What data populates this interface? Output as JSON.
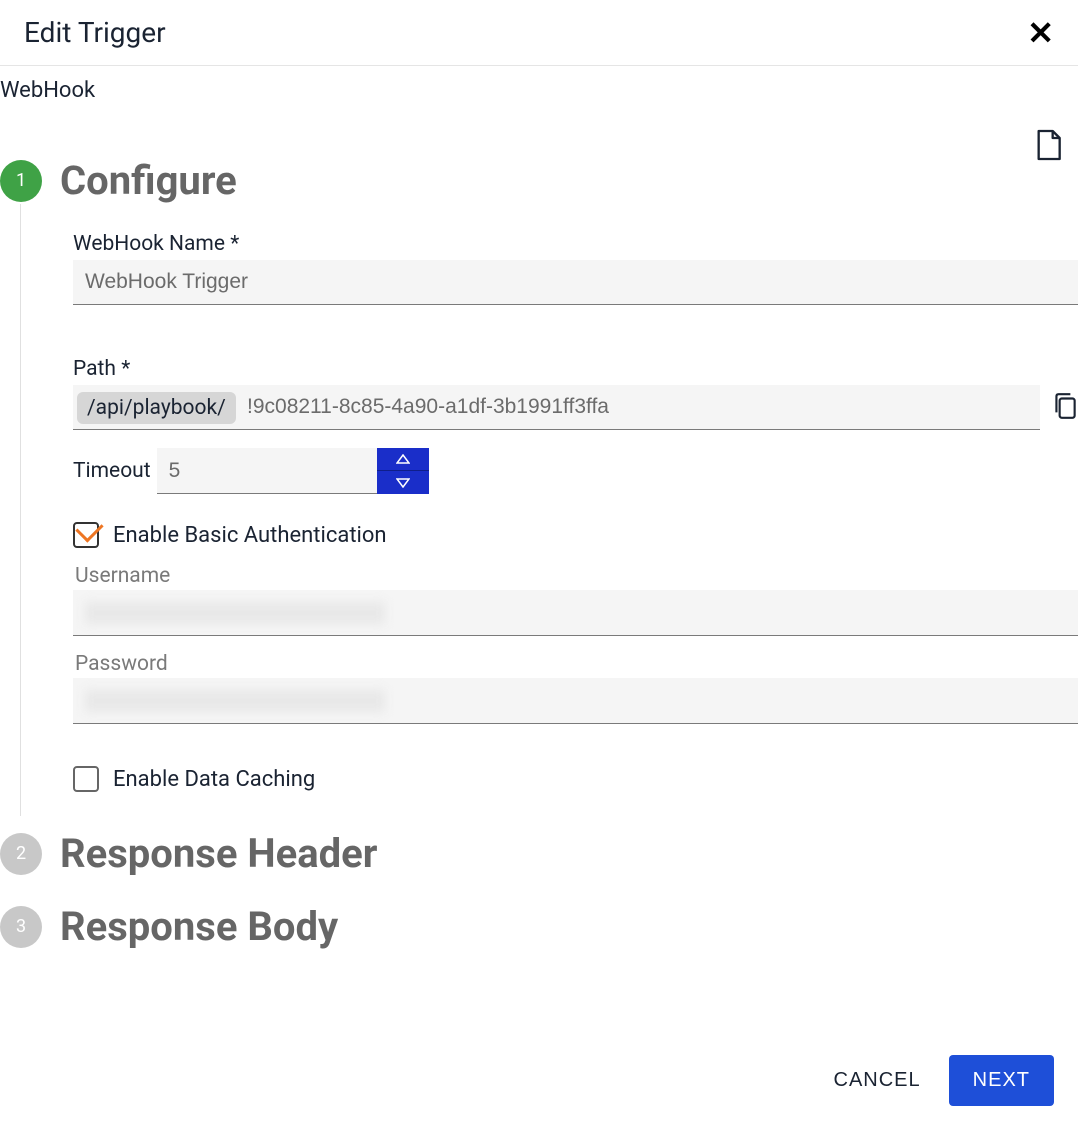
{
  "header": {
    "title": "Edit Trigger"
  },
  "subtitle": "WebHook",
  "steps": {
    "configure": {
      "num": "1",
      "title": "Configure"
    },
    "response_header": {
      "num": "2",
      "title": "Response Header"
    },
    "response_body": {
      "num": "3",
      "title": "Response Body"
    }
  },
  "form": {
    "name_label": "WebHook Name *",
    "name_value": "WebHook Trigger",
    "path_label": "Path *",
    "path_prefix": "/api/playbook/",
    "path_value": "!9c08211-8c85-4a90-a1df-3b1991ff3ffa",
    "timeout_label": "Timeout",
    "timeout_value": "5",
    "enable_auth_label": "Enable Basic Authentication",
    "username_label": "Username",
    "password_label": "Password",
    "enable_cache_label": "Enable Data Caching"
  },
  "footer": {
    "cancel": "CANCEL",
    "next": "NEXT"
  }
}
